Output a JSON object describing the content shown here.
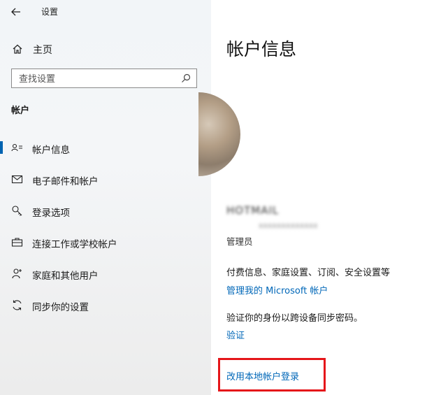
{
  "window": {
    "title": "设置"
  },
  "sidebar": {
    "home_label": "主页",
    "search": {
      "placeholder": "查找设置"
    },
    "section_title": "帐户",
    "items": [
      {
        "label": "帐户信息",
        "icon": "person-card-icon",
        "selected": true
      },
      {
        "label": "电子邮件和帐户",
        "icon": "mail-icon"
      },
      {
        "label": "登录选项",
        "icon": "key-icon"
      },
      {
        "label": "连接工作或学校帐户",
        "icon": "briefcase-icon"
      },
      {
        "label": "家庭和其他用户",
        "icon": "person-add-icon"
      },
      {
        "label": "同步你的设置",
        "icon": "sync-icon"
      }
    ]
  },
  "main": {
    "title": "帐户信息",
    "user": {
      "name": "HOTMAIL",
      "email": "xxxxxxxxxxxxx",
      "role": "管理员"
    },
    "billing_text": "付费信息、家庭设置、订阅、安全设置等",
    "manage_link": "管理我的 Microsoft 帐户",
    "verify_text": "验证你的身份以跨设备同步密码。",
    "verify_link": "验证",
    "local_account_link": "改用本地帐户登录"
  },
  "colors": {
    "accent": "#0063b1",
    "link": "#0067b8",
    "highlight_box": "#e5161a"
  }
}
